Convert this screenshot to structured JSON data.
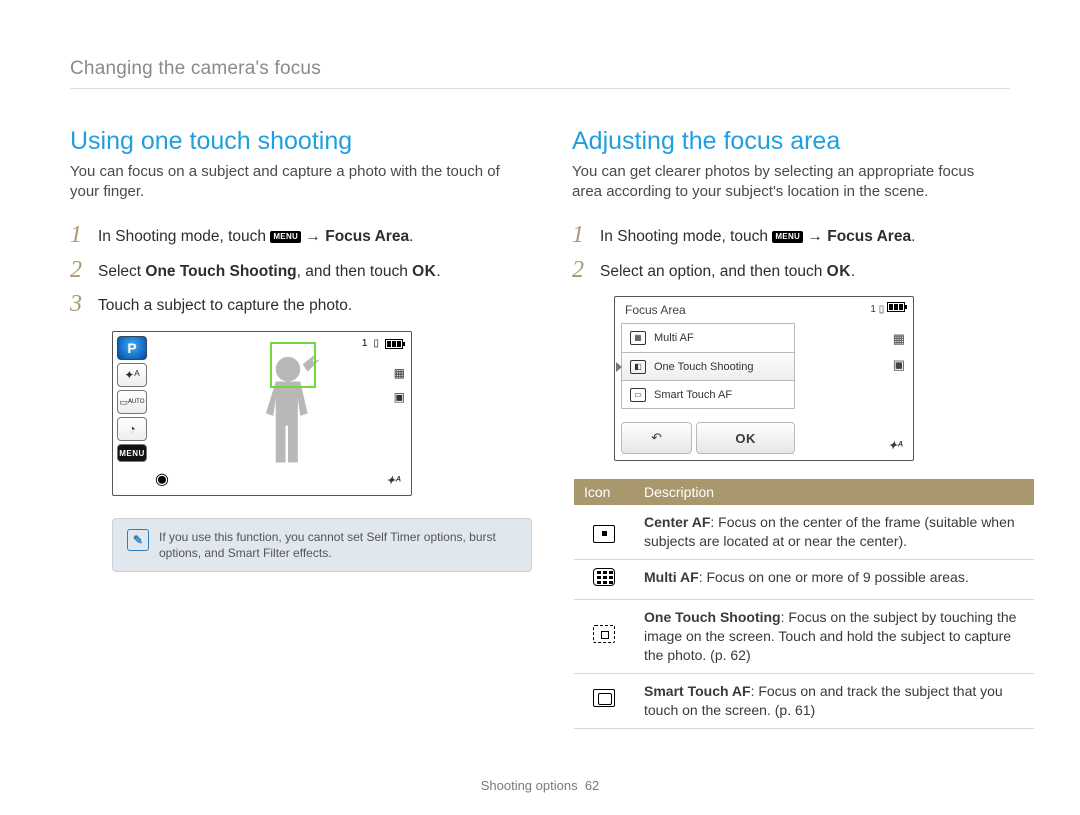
{
  "breadcrumb": "Changing the camera's focus",
  "left": {
    "heading": "Using one touch shooting",
    "intro": "You can focus on a subject and capture a photo with the touch of your finger.",
    "step1_a": "In Shooting mode, touch ",
    "step1_b": " → ",
    "step1_c": "Focus Area",
    "step1_d": ".",
    "step2_a": "Select ",
    "step2_b": "One Touch Shooting",
    "step2_c": ", and then touch ",
    "step2_d": ".",
    "step3": "Touch a subject to capture the photo.",
    "screen": {
      "mode": "P",
      "flash": "✦ᴬ",
      "auto": "▭ᴬᵁᵀᴼ",
      "timer": "◔",
      "menu": "MENU",
      "rec": "◉",
      "count": "1",
      "right1": "▦",
      "right2": "▣",
      "br": "✦ᴬ"
    },
    "note": "If you use this function, you cannot set Self Timer options, burst options, and Smart Filter effects."
  },
  "right": {
    "heading": "Adjusting the focus area",
    "intro": "You can get clearer photos by selecting an appropriate focus area according to your subject's location in the scene.",
    "step1_a": "In Shooting mode, touch ",
    "step1_b": " → ",
    "step1_c": "Focus Area",
    "step1_d": ".",
    "step2_a": "Select an option, and then touch ",
    "step2_b": ".",
    "screen": {
      "title": "Focus Area",
      "opt1": "Multi AF",
      "opt2": "One Touch Shooting",
      "opt3": "Smart Touch AF",
      "back": "↶",
      "ok": "OK",
      "count": "1",
      "side1": "▦",
      "side2": "▣",
      "br": "✦ᴬ"
    },
    "table": {
      "h1": "Icon",
      "h2": "Description",
      "r1_b": "Center AF",
      "r1": ": Focus on the center of the frame (suitable when subjects are located at or near the center).",
      "r2_b": "Multi AF",
      "r2": ": Focus on one or more of 9 possible areas.",
      "r3_b": "One Touch Shooting",
      "r3": ": Focus on the subject by touching the image on the screen. Touch and hold the subject to capture the photo. (p. 62)",
      "r4_b": "Smart Touch AF",
      "r4": ": Focus on and track the subject that you touch on the screen. (p. 61)"
    }
  },
  "menu_label": "MENU",
  "ok_label": "OK",
  "footer_a": "Shooting options",
  "footer_b": "62"
}
